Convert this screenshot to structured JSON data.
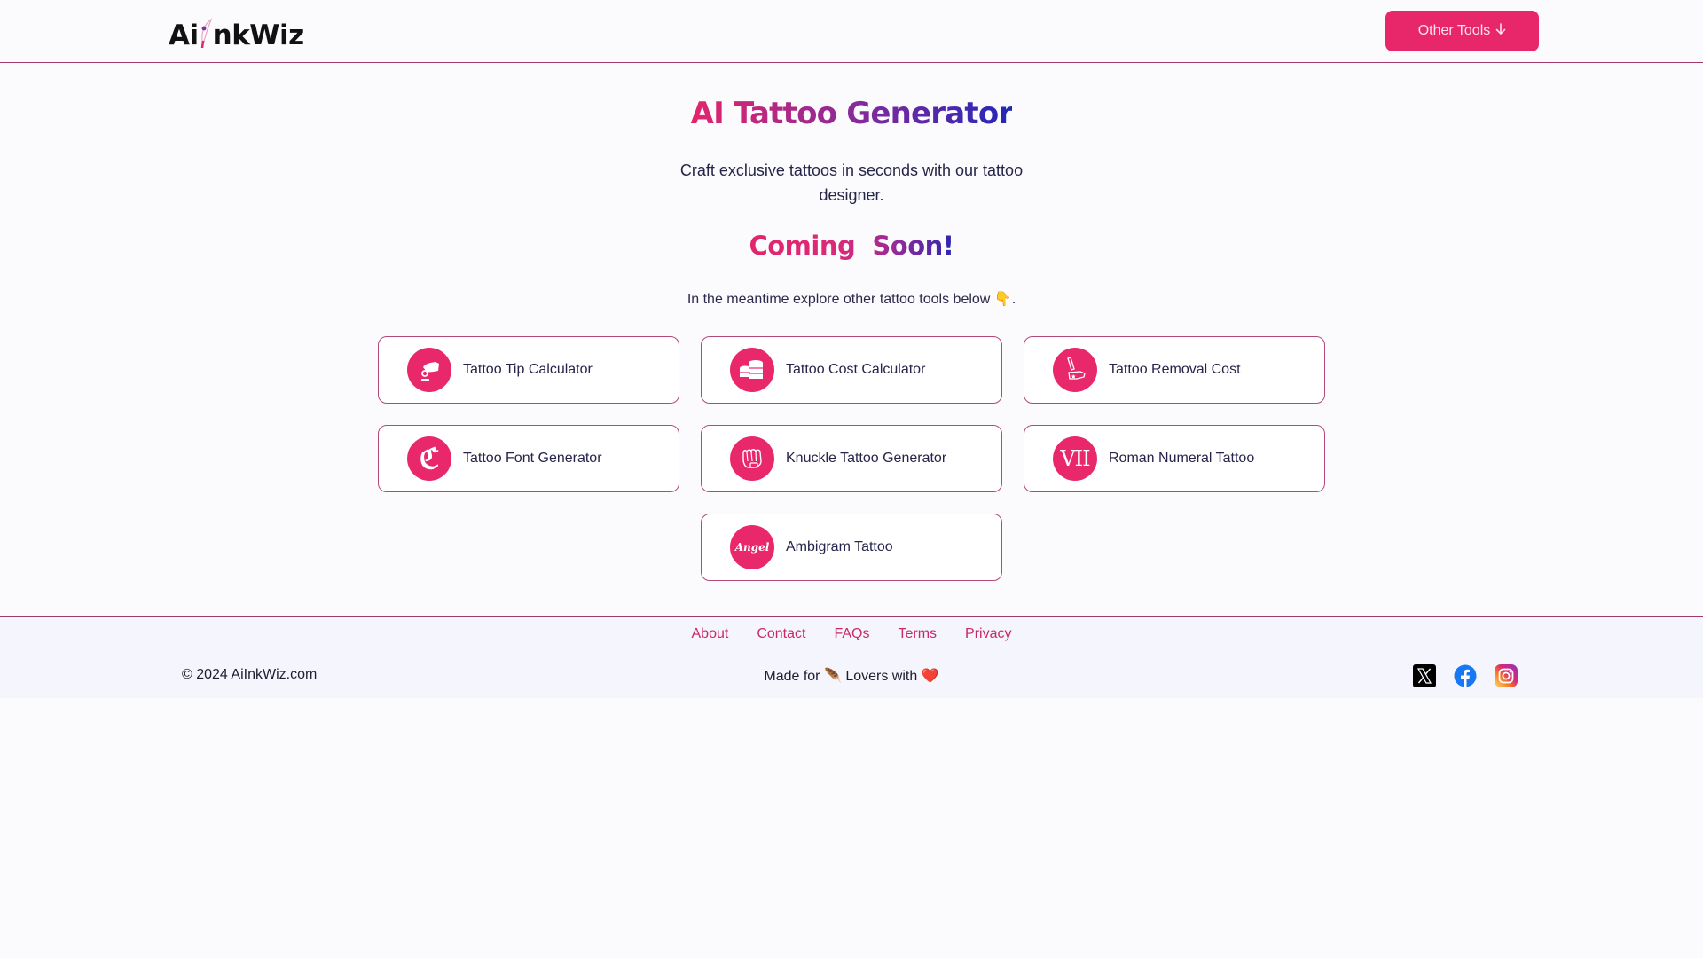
{
  "header": {
    "logo_prefix": "Ai",
    "logo_suffix": "nkWiz",
    "logo_icon": "quill-icon",
    "other_tools_label": "Other Tools",
    "other_tools_icon": "arrow-down-icon"
  },
  "main": {
    "title": "AI Tattoo Generator",
    "subtitle": "Craft exclusive tattoos in seconds with our tattoo designer.",
    "coming_soon": "Coming  Soon!",
    "meantime_text": "In the meantime explore other tattoo tools below",
    "meantime_emoji": "👇",
    "meantime_suffix": ".",
    "tools": [
      {
        "label": "Tattoo Tip Calculator",
        "icon": "tip-hand-icon"
      },
      {
        "label": "Tattoo Cost Calculator",
        "icon": "coins-stack-icon"
      },
      {
        "label": "Tattoo Removal Cost",
        "icon": "laser-hand-icon"
      },
      {
        "label": "Tattoo Font Generator",
        "icon": "gothic-letter-icon",
        "glyph": "ℭ"
      },
      {
        "label": "Knuckle Tattoo Generator",
        "icon": "fist-icon"
      },
      {
        "label": "Roman Numeral Tattoo",
        "icon": "roman-numeral-icon",
        "glyph": "VII"
      },
      {
        "label": "Ambigram Tattoo",
        "icon": "ambigram-icon",
        "glyph": "Angel"
      }
    ]
  },
  "footer": {
    "links": [
      "About",
      "Contact",
      "FAQs",
      "Terms",
      "Privacy"
    ],
    "copyright": "© 2024 AiInkWiz.com",
    "made_for_prefix": "Made for",
    "made_for_emoji": "🪶",
    "made_for_middle": "Lovers with",
    "made_for_heart": "❤️",
    "socials": [
      {
        "name": "X",
        "icon": "x-icon",
        "color": "#000000"
      },
      {
        "name": "Facebook",
        "icon": "facebook-icon",
        "color": "#1877f2"
      },
      {
        "name": "Instagram",
        "icon": "instagram-icon",
        "color": "#d62976"
      }
    ]
  },
  "colors": {
    "accent": "#e7276a",
    "border": "#a23a68",
    "link": "#c8286d",
    "background": "#fbfbfe"
  }
}
